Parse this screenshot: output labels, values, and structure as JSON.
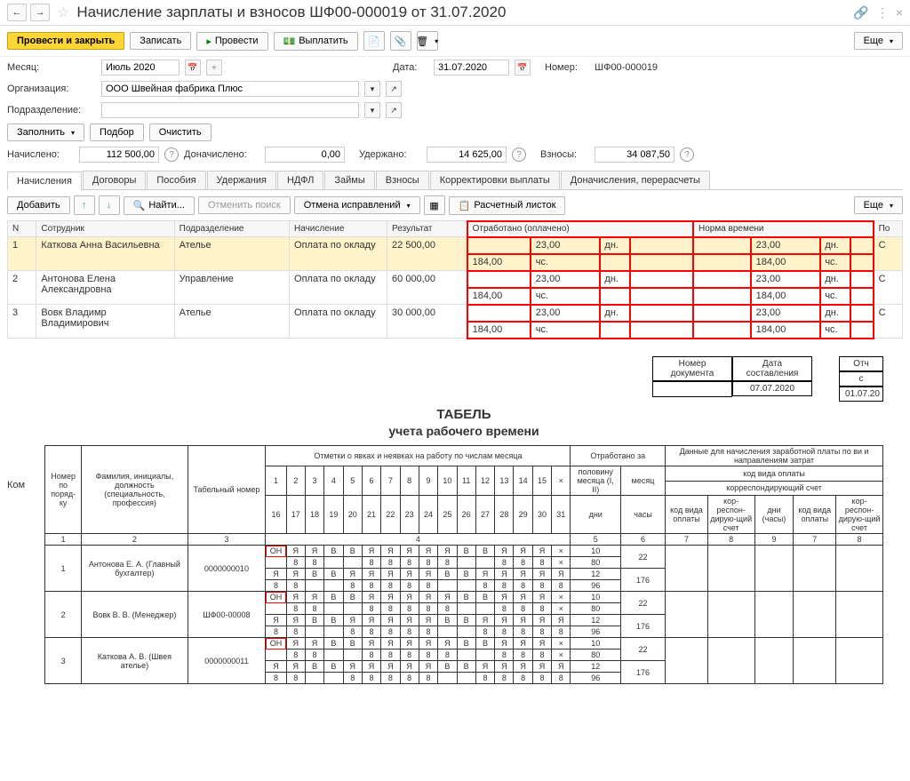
{
  "nav": {
    "back": "←",
    "fwd": "→",
    "star": "☆"
  },
  "title": "Начисление зарплаты и взносов ШФ00-000019 от 31.07.2020",
  "topright": {
    "link": "🔗",
    "more": "⋮",
    "close": "×"
  },
  "toolbar": {
    "conduct_close": "Провести и закрыть",
    "write": "Записать",
    "conduct": "Провести",
    "pay": "Выплатить",
    "more": "Еще"
  },
  "form": {
    "month_lbl": "Месяц:",
    "month_val": "Июль 2020",
    "date_lbl": "Дата:",
    "date_val": "31.07.2020",
    "number_lbl": "Номер:",
    "number_val": "ШФ00-000019",
    "org_lbl": "Организация:",
    "org_val": "ООО Швейная фабрика Плюс",
    "dept_lbl": "Подразделение:",
    "dept_val": "",
    "fill": "Заполнить",
    "select": "Подбор",
    "clear": "Очистить",
    "accrued_lbl": "Начислено:",
    "accrued_val": "112 500,00",
    "addaccr_lbl": "Доначислено:",
    "addaccr_val": "0,00",
    "withheld_lbl": "Удержано:",
    "withheld_val": "14 625,00",
    "contrib_lbl": "Взносы:",
    "contrib_val": "34 087,50"
  },
  "tabs": [
    "Начисления",
    "Договоры",
    "Пособия",
    "Удержания",
    "НДФЛ",
    "Займы",
    "Взносы",
    "Корректировки выплаты",
    "Доначисления, перерасчеты"
  ],
  "subtb": {
    "add": "Добавить",
    "find": "Найти...",
    "cancel_search": "Отменить поиск",
    "cancel_corr": "Отмена исправлений",
    "payslip": "Расчетный листок",
    "more": "Еще"
  },
  "grid": {
    "headers": {
      "n": "N",
      "emp": "Сотрудник",
      "dept": "Подразделение",
      "accr": "Начисление",
      "result": "Результат",
      "worked": "Отработано (оплачено)",
      "norm": "Норма времени",
      "p": "По",
      "dn": "дн.",
      "ch": "чс."
    },
    "rows": [
      {
        "n": "1",
        "emp": "Каткова Анна Васильевна",
        "dept": "Ателье",
        "accr": "Оплата по окладу",
        "result": "22 500,00",
        "wd": "23,00",
        "wh": "184,00",
        "nd": "23,00",
        "nh": "184,00",
        "p": "С"
      },
      {
        "n": "2",
        "emp": "Антонова Елена Александровна",
        "dept": "Управление",
        "accr": "Оплата по окладу",
        "result": "60 000,00",
        "wd": "23,00",
        "wh": "184,00",
        "nd": "23,00",
        "nh": "184,00",
        "p": "С"
      },
      {
        "n": "3",
        "emp": "Вовк Владимр Владимирович",
        "dept": "Ателье",
        "accr": "Оплата по окладу",
        "result": "30 000,00",
        "wd": "23,00",
        "wh": "184,00",
        "nd": "23,00",
        "nh": "184,00",
        "p": "С"
      }
    ]
  },
  "comment": "Ком",
  "sheet": {
    "docnum_lbl": "Номер документа",
    "docdate_lbl": "Дата составления",
    "docdate_val": "07.07.2020",
    "period_lbl": "Отч",
    "s": "с",
    "sval": "01.07.20",
    "title": "ТАБЕЛЬ",
    "subtitle": "учета  рабочего времени",
    "h": {
      "npp": "Номер по поряд-ку",
      "fio": "Фамилия, инициалы, должность (специальность, профессия)",
      "tabnum": "Табельный номер",
      "marks": "Отметки о явках и неявках на работу по числам месяца",
      "worked": "Отработано за",
      "half": "половину месяца (I, II)",
      "month": "месяц",
      "days": "дни",
      "hours": "часы",
      "data": "Данные для начисления заработной платы по ви и направлениям затрат",
      "code": "код вида оплаты",
      "corr": "корреспондирующий счет",
      "kod": "код вида оплаты",
      "kors": "кор-респон-дирую-щий счет",
      "dni": "дни (часы)"
    },
    "nums": [
      "1",
      "2",
      "3",
      "4",
      "5",
      "6",
      "7",
      "8",
      "9",
      "10",
      "11",
      "12",
      "13",
      "14",
      "15",
      "×"
    ],
    "nums2": [
      "16",
      "17",
      "18",
      "19",
      "20",
      "21",
      "22",
      "23",
      "24",
      "25",
      "26",
      "27",
      "28",
      "29",
      "30",
      "31"
    ],
    "colnums": [
      "1",
      "2",
      "3",
      "4",
      "5",
      "6",
      "7",
      "8",
      "9",
      "7",
      "8"
    ],
    "rows": [
      {
        "n": "1",
        "fio": "Антонова Е. А. (Главный бухгалтер)",
        "tab": "0000000010",
        "r1": [
          "ОН",
          "Я",
          "Я",
          "В",
          "В",
          "Я",
          "Я",
          "Я",
          "Я",
          "Я",
          "В",
          "В",
          "Я",
          "Я",
          "Я",
          "×"
        ],
        "v1": "10",
        "r2": [
          "8",
          "8",
          "",
          "",
          "8",
          "8",
          "8",
          "8",
          "8",
          "",
          "",
          "8",
          "8",
          "8",
          "×"
        ],
        "v2": "80",
        "m1": "22",
        "r3": [
          "Я",
          "Я",
          "В",
          "В",
          "Я",
          "Я",
          "Я",
          "Я",
          "Я",
          "В",
          "В",
          "Я",
          "Я",
          "Я",
          "Я",
          "Я"
        ],
        "v3": "12",
        "r4": [
          "8",
          "8",
          "",
          "",
          "8",
          "8",
          "8",
          "8",
          "8",
          "",
          "",
          "8",
          "8",
          "8",
          "8",
          "8"
        ],
        "v4": "96",
        "m2": "176"
      },
      {
        "n": "2",
        "fio": "Вовк В. В. (Менеджер)",
        "tab": "ШФ00-00008",
        "r1": [
          "ОН",
          "Я",
          "Я",
          "В",
          "В",
          "Я",
          "Я",
          "Я",
          "Я",
          "Я",
          "В",
          "В",
          "Я",
          "Я",
          "Я",
          "×"
        ],
        "v1": "10",
        "r2": [
          "8",
          "8",
          "",
          "",
          "8",
          "8",
          "8",
          "8",
          "8",
          "",
          "",
          "8",
          "8",
          "8",
          "×"
        ],
        "v2": "80",
        "m1": "22",
        "r3": [
          "Я",
          "Я",
          "В",
          "В",
          "Я",
          "Я",
          "Я",
          "Я",
          "Я",
          "В",
          "В",
          "Я",
          "Я",
          "Я",
          "Я",
          "Я"
        ],
        "v3": "12",
        "r4": [
          "8",
          "8",
          "",
          "",
          "8",
          "8",
          "8",
          "8",
          "8",
          "",
          "",
          "8",
          "8",
          "8",
          "8",
          "8"
        ],
        "v4": "96",
        "m2": "176"
      },
      {
        "n": "3",
        "fio": "Каткова А. В. (Швея ателье)",
        "tab": "0000000011",
        "r1": [
          "ОН",
          "Я",
          "Я",
          "В",
          "В",
          "Я",
          "Я",
          "Я",
          "Я",
          "Я",
          "В",
          "В",
          "Я",
          "Я",
          "Я",
          "×"
        ],
        "v1": "10",
        "r2": [
          "8",
          "8",
          "",
          "",
          "8",
          "8",
          "8",
          "8",
          "8",
          "",
          "",
          "8",
          "8",
          "8",
          "×"
        ],
        "v2": "80",
        "m1": "22",
        "r3": [
          "Я",
          "Я",
          "В",
          "В",
          "Я",
          "Я",
          "Я",
          "Я",
          "Я",
          "В",
          "В",
          "Я",
          "Я",
          "Я",
          "Я",
          "Я"
        ],
        "v3": "12",
        "r4": [
          "8",
          "8",
          "",
          "",
          "8",
          "8",
          "8",
          "8",
          "8",
          "",
          "",
          "8",
          "8",
          "8",
          "8",
          "8"
        ],
        "v4": "96",
        "m2": "176"
      }
    ]
  }
}
